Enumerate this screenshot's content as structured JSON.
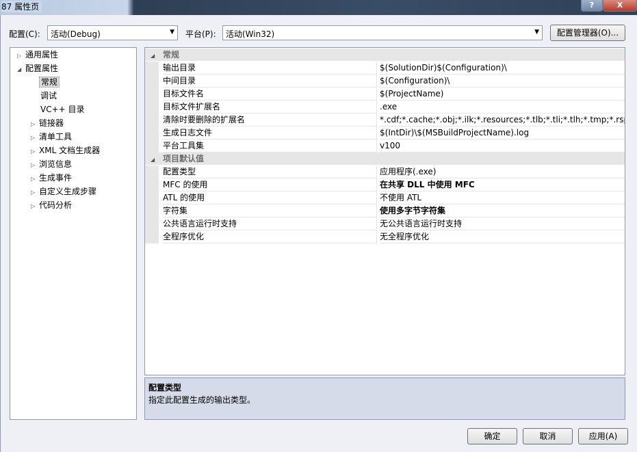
{
  "window": {
    "title": "87 属性页",
    "help_label": "?",
    "close_label": "X"
  },
  "config": {
    "label": "配置(C):",
    "value": "活动(Debug)"
  },
  "platform": {
    "label": "平台(P):",
    "value": "活动(Win32)"
  },
  "config_manager_label": "配置管理器(O)...",
  "tree": {
    "items": [
      {
        "label": "通用属性",
        "expander": "▷"
      },
      {
        "label": "配置属性",
        "expander": "◢"
      },
      {
        "label": "常规",
        "expander": ""
      },
      {
        "label": "调试",
        "expander": ""
      },
      {
        "label": "VC++ 目录",
        "expander": ""
      },
      {
        "label": "链接器",
        "expander": "▷"
      },
      {
        "label": "清单工具",
        "expander": "▷"
      },
      {
        "label": "XML 文档生成器",
        "expander": "▷"
      },
      {
        "label": "浏览信息",
        "expander": "▷"
      },
      {
        "label": "生成事件",
        "expander": "▷"
      },
      {
        "label": "自定义生成步骤",
        "expander": "▷"
      },
      {
        "label": "代码分析",
        "expander": "▷"
      }
    ]
  },
  "grid": {
    "categories": [
      {
        "label": "常规",
        "expander": "◢"
      },
      {
        "label": "项目默认值",
        "expander": "◢"
      }
    ],
    "rows": [
      {
        "name": "输出目录",
        "value": "$(SolutionDir)$(Configuration)\\"
      },
      {
        "name": "中间目录",
        "value": "$(Configuration)\\"
      },
      {
        "name": "目标文件名",
        "value": "$(ProjectName)"
      },
      {
        "name": "目标文件扩展名",
        "value": ".exe"
      },
      {
        "name": "清除时要删除的扩展名",
        "value": "*.cdf;*.cache;*.obj;*.ilk;*.resources;*.tlb;*.tli;*.tlh;*.tmp;*.rsp;*.pgc"
      },
      {
        "name": "生成日志文件",
        "value": "$(IntDir)\\$(MSBuildProjectName).log"
      },
      {
        "name": "平台工具集",
        "value": "v100"
      },
      {
        "name": "配置类型",
        "value": "应用程序(.exe)"
      },
      {
        "name": "MFC 的使用",
        "value": "在共享 DLL 中使用 MFC"
      },
      {
        "name": "ATL 的使用",
        "value": "不使用 ATL"
      },
      {
        "name": "字符集",
        "value": "使用多字节字符集"
      },
      {
        "name": "公共语言运行时支持",
        "value": "无公共语言运行时支持"
      },
      {
        "name": "全程序优化",
        "value": "无全程序优化"
      }
    ]
  },
  "description": {
    "title": "配置类型",
    "text": "指定此配置生成的输出类型。"
  },
  "buttons": {
    "ok": "确定",
    "cancel": "取消",
    "apply": "应用(A)"
  }
}
